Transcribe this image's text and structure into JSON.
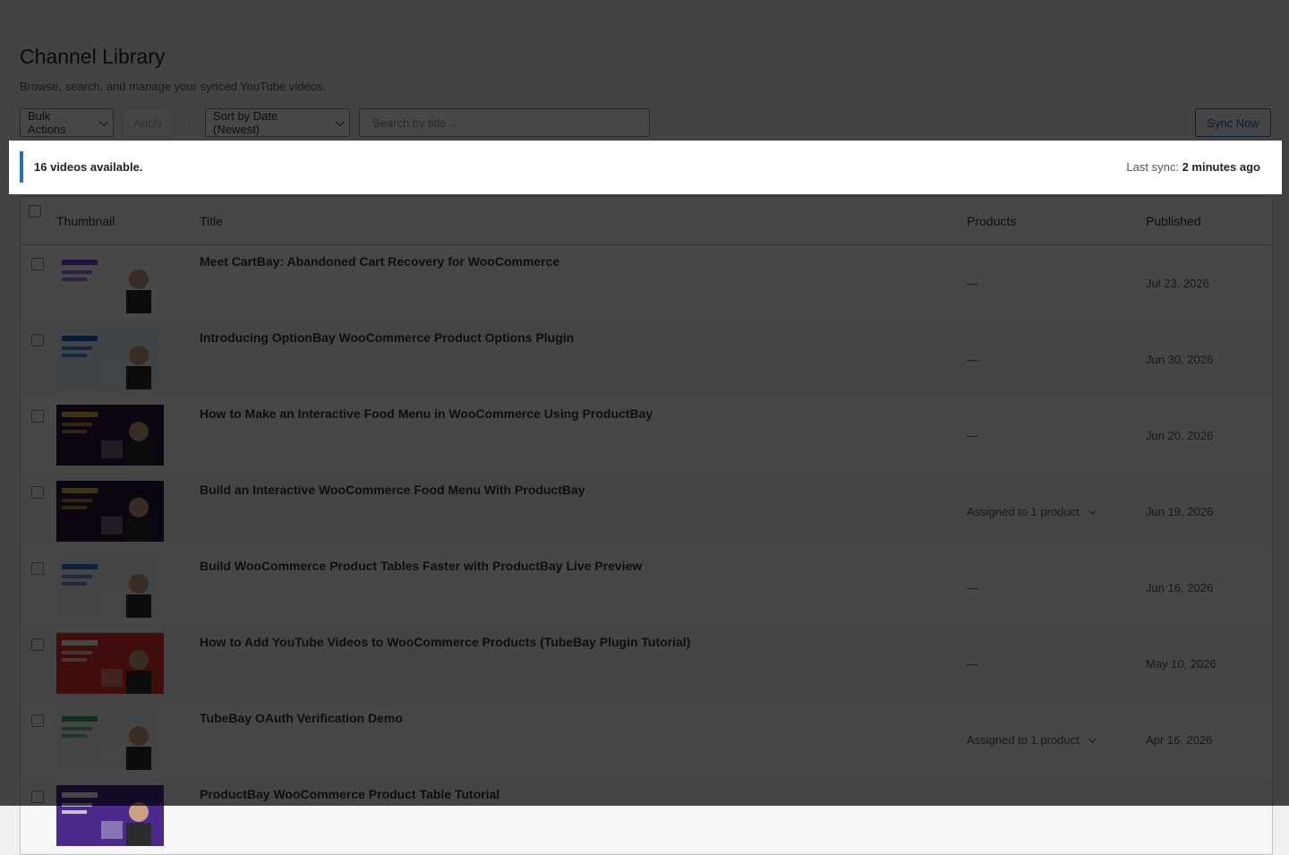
{
  "header": {
    "title": "Channel Library",
    "subtitle": "Browse, search, and manage your synced YouTube videos."
  },
  "toolbar": {
    "bulk_label": "Bulk Actions",
    "apply_label": "Apply",
    "sort_label": "Sort by Date (Newest)",
    "search_placeholder": "Search by title...",
    "sync_label": "Sync Now"
  },
  "notice": {
    "count_text": "16 videos available.",
    "last_sync_label": "Last sync:",
    "last_sync_value": "2 minutes ago"
  },
  "table": {
    "columns": {
      "thumbnail": "Thumbnail",
      "title": "Title",
      "products": "Products",
      "published": "Published"
    },
    "rows": [
      {
        "title": "Meet CartBay: Abandoned Cart Recovery for WooCommerce",
        "products": "—",
        "published": "Jul 23, 2026",
        "thumb_bg": "#ffffff",
        "thumb_accent": "#7b3fe4"
      },
      {
        "title": "Introducing OptionBay WooCommerce Product Options Plugin",
        "products": "—",
        "published": "Jun 30, 2026",
        "thumb_bg": "#eaf2ff",
        "thumb_accent": "#1e63c4"
      },
      {
        "title": "How to Make an Interactive Food Menu in WooCommerce Using ProductBay",
        "products": "—",
        "published": "Jun 20, 2026",
        "thumb_bg": "#2a1638",
        "thumb_accent": "#e3b341"
      },
      {
        "title": "Build an Interactive WooCommerce Food Menu With ProductBay",
        "products": "Assigned to 1 product",
        "published": "Jun 19, 2026",
        "thumb_bg": "#2a1638",
        "thumb_accent": "#e3b341"
      },
      {
        "title": "Build WooCommerce Product Tables Faster with ProductBay Live Preview",
        "products": "—",
        "published": "Jun 16, 2026",
        "thumb_bg": "#f3f6fb",
        "thumb_accent": "#3b6fd6"
      },
      {
        "title": "How to Add YouTube Videos to WooCommerce Products (TubeBay Plugin Tutorial)",
        "products": "—",
        "published": "May 10, 2026",
        "thumb_bg": "#e0342b",
        "thumb_accent": "#ffffff"
      },
      {
        "title": "TubeBay OAuth Verification Demo",
        "products": "Assigned to 1 product",
        "published": "Apr 16, 2026",
        "thumb_bg": "#f8f8f8",
        "thumb_accent": "#3ea86b"
      },
      {
        "title": "ProductBay WooCommerce Product Table Tutorial",
        "products": "",
        "published": "",
        "thumb_bg": "#4b2a8c",
        "thumb_accent": "#ffffff"
      }
    ]
  }
}
